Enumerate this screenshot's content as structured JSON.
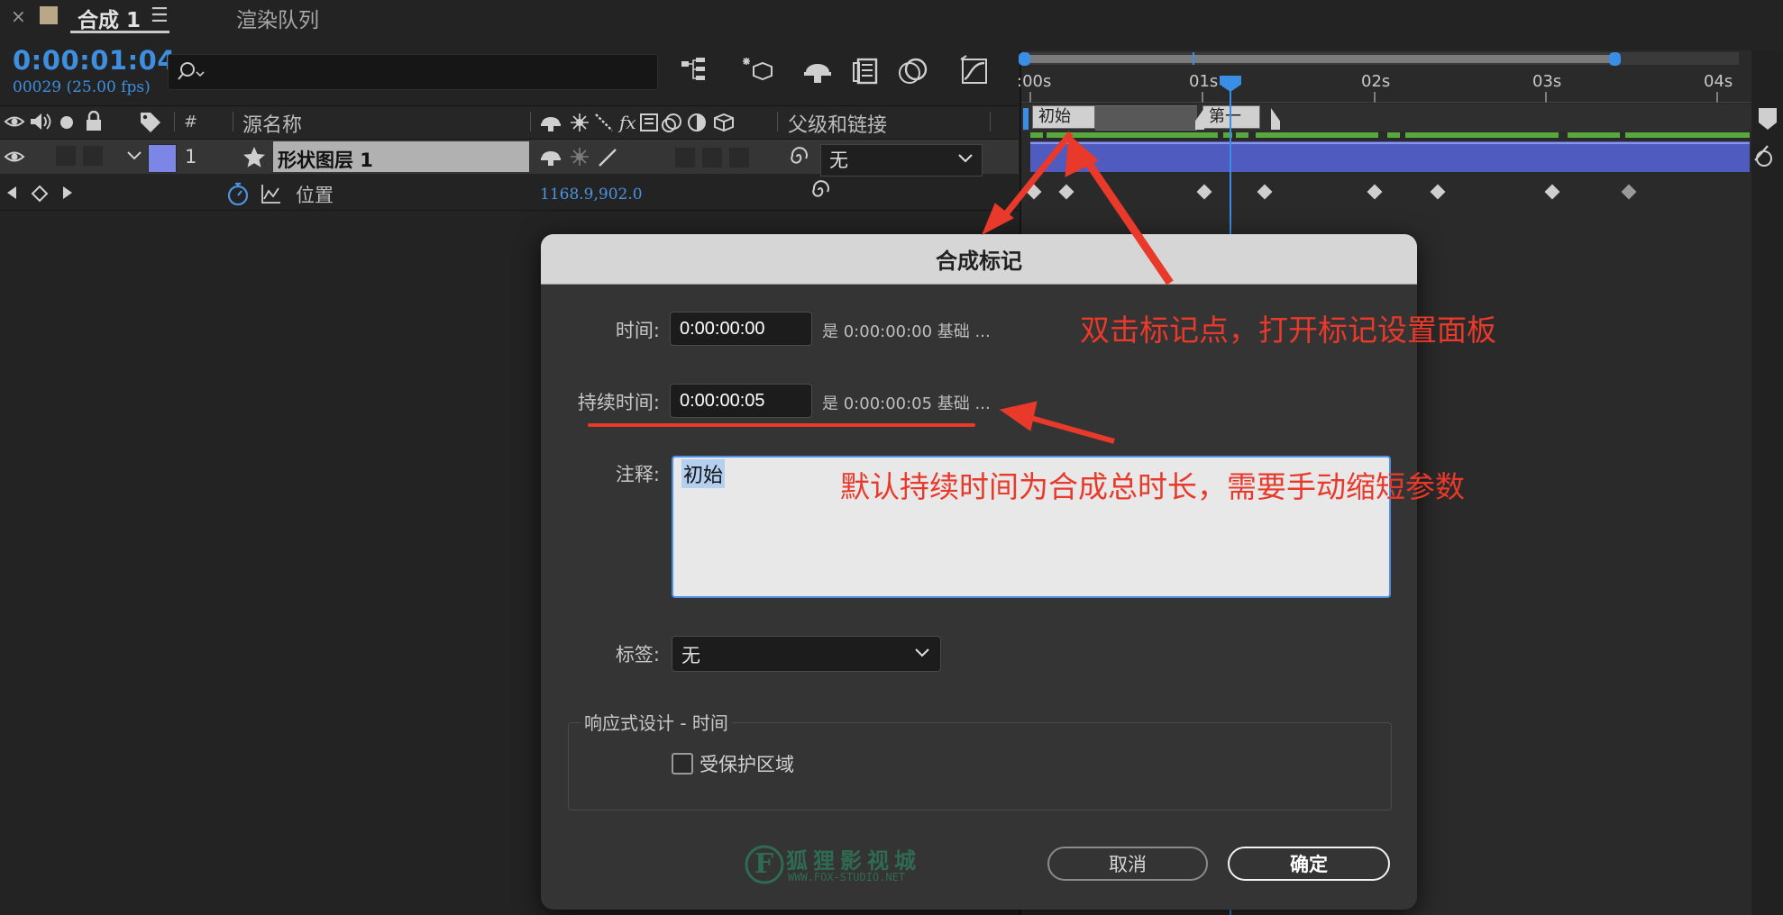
{
  "tabs": {
    "close_glyph": "×",
    "active_label": "合成 1",
    "menu_glyph": "☰",
    "other_label": "渲染队列"
  },
  "time": {
    "timecode": "0:00:01:04",
    "frames_fps": "00029 (25.00 fps)"
  },
  "search": {
    "placeholder": ""
  },
  "columns": {
    "hash": "#",
    "source_name": "源名称",
    "parent_link": "父级和链接"
  },
  "layer": {
    "number": "1",
    "name": "形状图层 1",
    "parent_value": "无",
    "color": "#7b86e6"
  },
  "property": {
    "name": "位置",
    "value": "1168.9,902.0"
  },
  "ruler": {
    "labels": [
      ":00s",
      "01s",
      "02s",
      "03s",
      "04s"
    ]
  },
  "markers": [
    {
      "label": "初始"
    },
    {
      "label": "第一"
    }
  ],
  "dialog": {
    "title": "合成标记",
    "time_label": "时间:",
    "time_value": "0:00:00:00",
    "time_note": "是 0:00:00:00  基础 ...",
    "duration_label": "持续时间:",
    "duration_value": "0:00:00:05",
    "duration_note": "是 0:00:00:05  基础 ...",
    "comment_label": "注释:",
    "comment_value": "初始",
    "tag_label": "标签:",
    "tag_value": "无",
    "responsive_legend": "响应式设计 - 时间",
    "protected_label": "受保护区域",
    "protected_checked": false,
    "cancel_label": "取消",
    "ok_label": "确定"
  },
  "watermark": {
    "letter": "F",
    "name": "狐狸影视城",
    "url": "WWW.FOX-STUDIO.NET"
  },
  "annotations": {
    "top": "双击标记点，打开标记设置面板",
    "middle": "默认持续时间为合成总时长，需要手动缩短参数"
  },
  "colors": {
    "accent_blue": "#3f8fe0",
    "annotation_red": "#e8392a",
    "layer_bar": "#4a55b9",
    "green_bar": "#58a83c"
  }
}
